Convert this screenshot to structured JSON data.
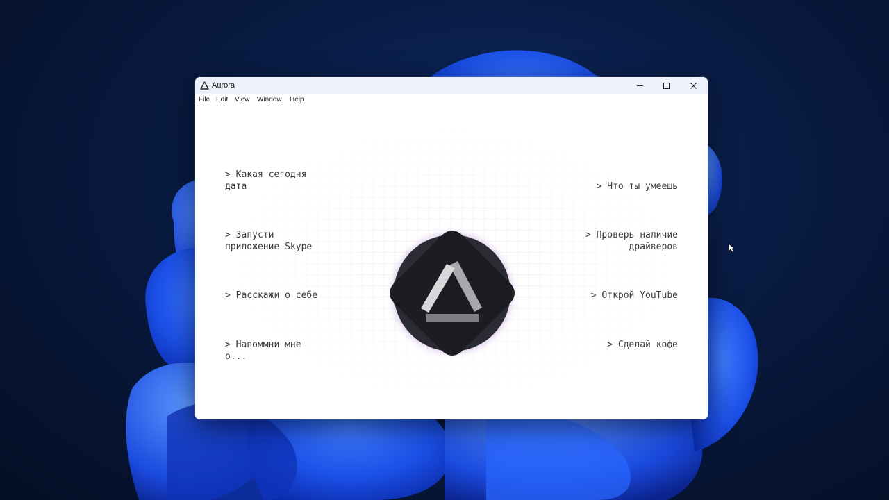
{
  "window": {
    "title": "Aurora",
    "icon": "aurora-triangle-icon"
  },
  "controls": {
    "minimize": "minimize-icon",
    "maximize": "maximize-icon",
    "close": "close-icon"
  },
  "menu": [
    "File",
    "Edit",
    "View",
    "Window",
    "Help"
  ],
  "suggestions": {
    "left": [
      "> Какая сегодня\nдата",
      "> Запусти\nприложение Skype",
      "> Расскажи о себе",
      "> Напоммни мне\nо..."
    ],
    "right": [
      "> Что ты умеешь",
      "> Проверь наличие\nдрайверов",
      "> Открой YouTube",
      "> Сделай кофе"
    ]
  },
  "logo": "aurora-logo-icon",
  "colors": {
    "desktop_bg": "#081a40",
    "wallpaper_blue": "#1f5bff",
    "titlebar": "#eef0fa",
    "logo_dark": "#1b1d22",
    "logo_glow": "#b58ad6"
  }
}
